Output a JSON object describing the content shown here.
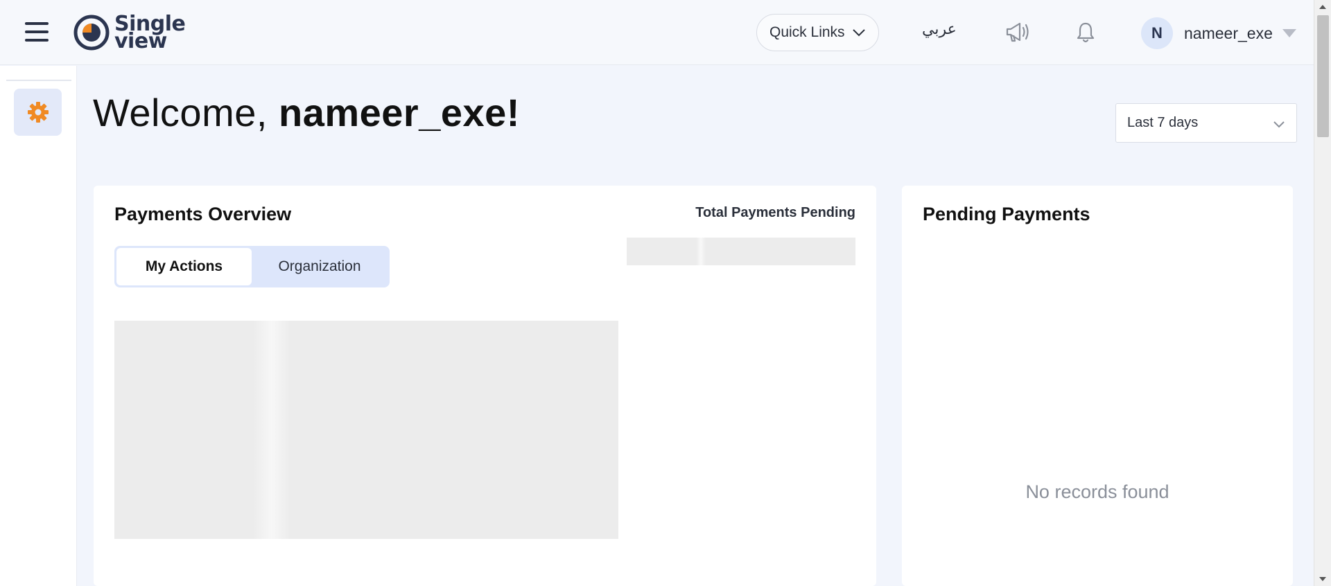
{
  "header": {
    "logo": {
      "line1": "Single",
      "line2": "view"
    },
    "quick_links_label": "Quick Links",
    "language_link": "عربي",
    "user": {
      "initial": "N",
      "name": "nameer_exe"
    }
  },
  "sidebar": {
    "items": [
      {
        "icon": "gear-icon",
        "label": "Settings"
      }
    ]
  },
  "main": {
    "welcome_prefix": "Welcome, ",
    "welcome_name": "nameer_exe!",
    "date_range": {
      "selected": "Last 7 days"
    }
  },
  "payments_overview": {
    "title": "Payments Overview",
    "tabs": [
      {
        "label": "My Actions",
        "active": true
      },
      {
        "label": "Organization",
        "active": false
      }
    ],
    "total_label": "Total Payments Pending"
  },
  "pending_payments": {
    "title": "Pending Payments",
    "empty_message": "No records found"
  },
  "colors": {
    "brand_navy": "#2b3550",
    "accent_orange": "#f08a24",
    "background": "#f2f5fc",
    "tab_track": "#dde6fb"
  }
}
